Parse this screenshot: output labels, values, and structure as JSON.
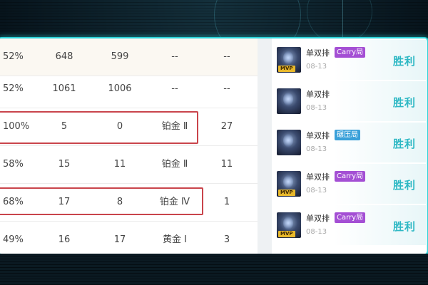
{
  "table": {
    "rows": [
      {
        "c1": "52%",
        "c2": "648",
        "c3": "599",
        "c4": "--",
        "c5": "--"
      },
      {
        "c1": "52%",
        "c2": "1061",
        "c3": "1006",
        "c4": "--",
        "c5": "--"
      },
      {
        "c1": "100%",
        "c2": "5",
        "c3": "0",
        "c4": "铂金 Ⅱ",
        "c5": "27"
      },
      {
        "c1": "58%",
        "c2": "15",
        "c3": "11",
        "c4": "铂金 Ⅱ",
        "c5": "11"
      },
      {
        "c1": "68%",
        "c2": "17",
        "c3": "8",
        "c4": "铂金 Ⅳ",
        "c5": "1"
      },
      {
        "c1": "49%",
        "c2": "16",
        "c3": "17",
        "c4": "黄金 Ⅰ",
        "c5": "3"
      }
    ]
  },
  "matches": [
    {
      "mode": "单双排",
      "tag": "Carry局",
      "tag_type": "carry",
      "date": "08-13",
      "result": "胜利",
      "mvp": "MVP"
    },
    {
      "mode": "单双排",
      "tag": "",
      "tag_type": "",
      "date": "08-13",
      "result": "胜利",
      "mvp": ""
    },
    {
      "mode": "单双排",
      "tag": "碾压局",
      "tag_type": "press",
      "date": "08-13",
      "result": "胜利",
      "mvp": ""
    },
    {
      "mode": "单双排",
      "tag": "Carry局",
      "tag_type": "carry",
      "date": "08-13",
      "result": "胜利",
      "mvp": "MVP"
    },
    {
      "mode": "单双排",
      "tag": "Carry局",
      "tag_type": "carry",
      "date": "08-13",
      "result": "胜利",
      "mvp": "MVP"
    }
  ],
  "colors": {
    "frame": "#2bd3d9",
    "highlight_box": "#c9444b",
    "win_text": "#2eb8c4",
    "carry_tag": "#a44fd4",
    "press_tag": "#3aa0d9",
    "mvp_badge": "#e8b82a"
  }
}
